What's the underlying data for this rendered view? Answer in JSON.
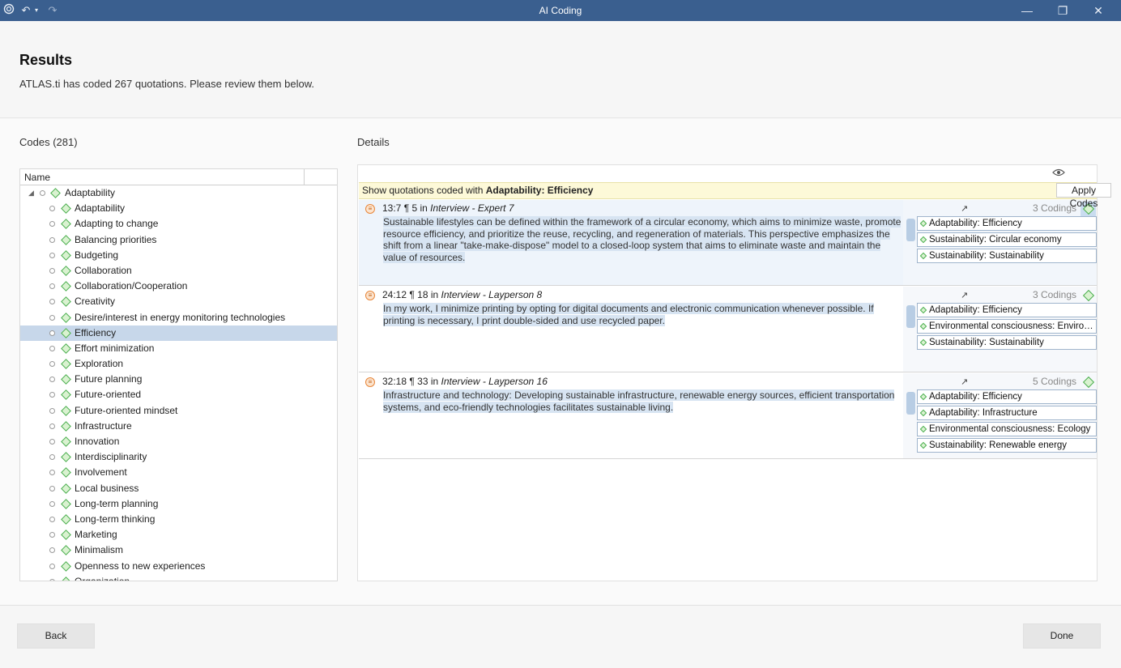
{
  "window": {
    "title": "AI Coding"
  },
  "header": {
    "title": "Results",
    "subtitle": "ATLAS.ti has coded 267 quotations. Please review them below."
  },
  "codes": {
    "label": "Codes (281)",
    "column_header": "Name",
    "root": "Adaptability",
    "items": [
      {
        "label": "Adaptability",
        "selected": false
      },
      {
        "label": "Adapting to change",
        "selected": false
      },
      {
        "label": "Balancing priorities",
        "selected": false
      },
      {
        "label": "Budgeting",
        "selected": false
      },
      {
        "label": "Collaboration",
        "selected": false
      },
      {
        "label": "Collaboration/Cooperation",
        "selected": false
      },
      {
        "label": "Creativity",
        "selected": false
      },
      {
        "label": "Desire/interest in energy monitoring  technologies",
        "selected": false
      },
      {
        "label": "Efficiency",
        "selected": true
      },
      {
        "label": "Effort minimization",
        "selected": false
      },
      {
        "label": "Exploration",
        "selected": false
      },
      {
        "label": "Future planning",
        "selected": false
      },
      {
        "label": "Future-oriented",
        "selected": false
      },
      {
        "label": "Future-oriented mindset",
        "selected": false
      },
      {
        "label": "Infrastructure",
        "selected": false
      },
      {
        "label": "Innovation",
        "selected": false
      },
      {
        "label": "Interdisciplinarity",
        "selected": false
      },
      {
        "label": "Involvement",
        "selected": false
      },
      {
        "label": "Local business",
        "selected": false
      },
      {
        "label": "Long-term planning",
        "selected": false
      },
      {
        "label": "Long-term thinking",
        "selected": false
      },
      {
        "label": "Marketing",
        "selected": false
      },
      {
        "label": "Minimalism",
        "selected": false
      },
      {
        "label": "Openness to new experiences",
        "selected": false
      },
      {
        "label": "Organization",
        "selected": false
      }
    ]
  },
  "details": {
    "label": "Details",
    "filter_prefix": "Show quotations coded with ",
    "filter_code": "Adaptability: Efficiency",
    "apply_codes": "Apply Codes",
    "quotations": [
      {
        "id": "13:7 ¶ 5 in ",
        "doc": "Interview - Expert 7",
        "text": "Sustainable lifestyles can be defined within the framework of a circular economy, which aims to minimize waste, promote resource efficiency, and prioritize the reuse, recycling, and regeneration of materials. This perspective emphasizes the shift from a linear \"take-make-dispose\" model to a closed-loop system that aims to eliminate waste and maintain the value of resources.",
        "codings": "3 Codings",
        "codes": [
          "Adaptability: Efficiency",
          "Sustainability: Circular economy",
          "Sustainability: Sustainability"
        ]
      },
      {
        "id": "24:12 ¶ 18 in ",
        "doc": "Interview - Layperson 8",
        "text": "In my work, I minimize printing by opting for digital documents and electronic communication whenever possible. If printing is necessary, I print double-sided and use recycled paper.",
        "codings": "3 Codings",
        "codes": [
          "Adaptability: Efficiency",
          "Environmental consciousness: Environm...",
          "Sustainability: Sustainability"
        ]
      },
      {
        "id": "32:18 ¶ 33 in ",
        "doc": "Interview - Layperson 16",
        "text": "Infrastructure and technology: Developing sustainable infrastructure, renewable energy sources, efficient transportation systems, and eco-friendly technologies facilitates sustainable living.",
        "codings": "5 Codings",
        "codes": [
          "Adaptability: Efficiency",
          "Adaptability: Infrastructure",
          "Environmental consciousness: Ecology",
          "Sustainability: Renewable energy"
        ]
      }
    ]
  },
  "footer": {
    "back": "Back",
    "done": "Done"
  }
}
